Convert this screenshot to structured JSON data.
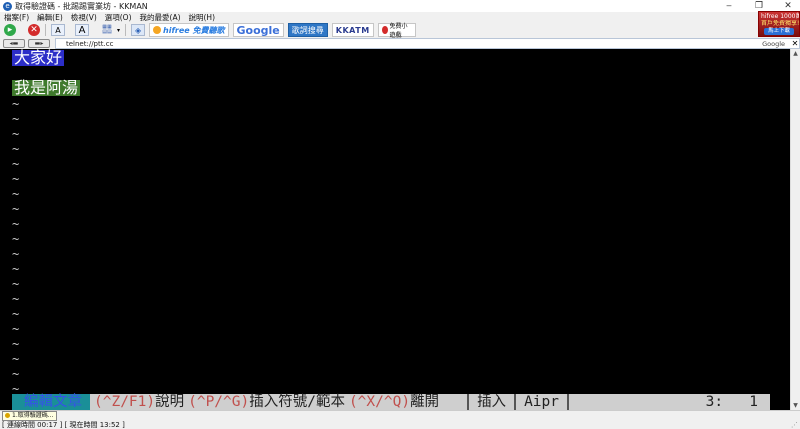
{
  "window": {
    "title": "取得驗證碼 - 批踢踢實業坊 - KKMAN",
    "controls": [
      "‒",
      "❐",
      "✕"
    ]
  },
  "menu": [
    "檔案(F)",
    "編輯(E)",
    "檢視(V)",
    "選項(O)",
    "我的最愛(A)",
    "說明(H)"
  ],
  "toolbar": {
    "partners": [
      "hifree 免費聽歌",
      "Google",
      "歌詞搜尋",
      "KKATM",
      "免費小遊戲"
    ]
  },
  "ad": {
    "line1": "hifree 1000萬首",
    "line2": "首戶免費獨享!",
    "button": "馬上下載"
  },
  "address": {
    "url": "telnet://ptt.cc",
    "search_label": "Google",
    "close": "✕"
  },
  "terminal": {
    "line1": "大家好",
    "line2": "我是阿湯",
    "tilde": "~",
    "tilde_count": 20,
    "status": {
      "mode": "編輯文章",
      "help1_key": "(^Z/F1)",
      "help1_text": "說明",
      "help2_key": "(^P/^G)",
      "help2_text": "插入符號/範本",
      "help3_key": "(^X/^Q)",
      "help3_text": "離開",
      "insert": "插入",
      "flags": "Aipr",
      "position": "3:   1"
    }
  },
  "statusbar": {
    "tooltip": "1.取得驗證碼...",
    "text": "[ 連線時間 00:17 ] [ 現在時間 13:52 ]"
  },
  "colors": {
    "terminal_bg": "#000000",
    "line1_bg": "#2c2ec8",
    "line2_bg": "#3f7a2c",
    "mode_bg": "#1a8f98",
    "key_fg": "#c0504d"
  }
}
